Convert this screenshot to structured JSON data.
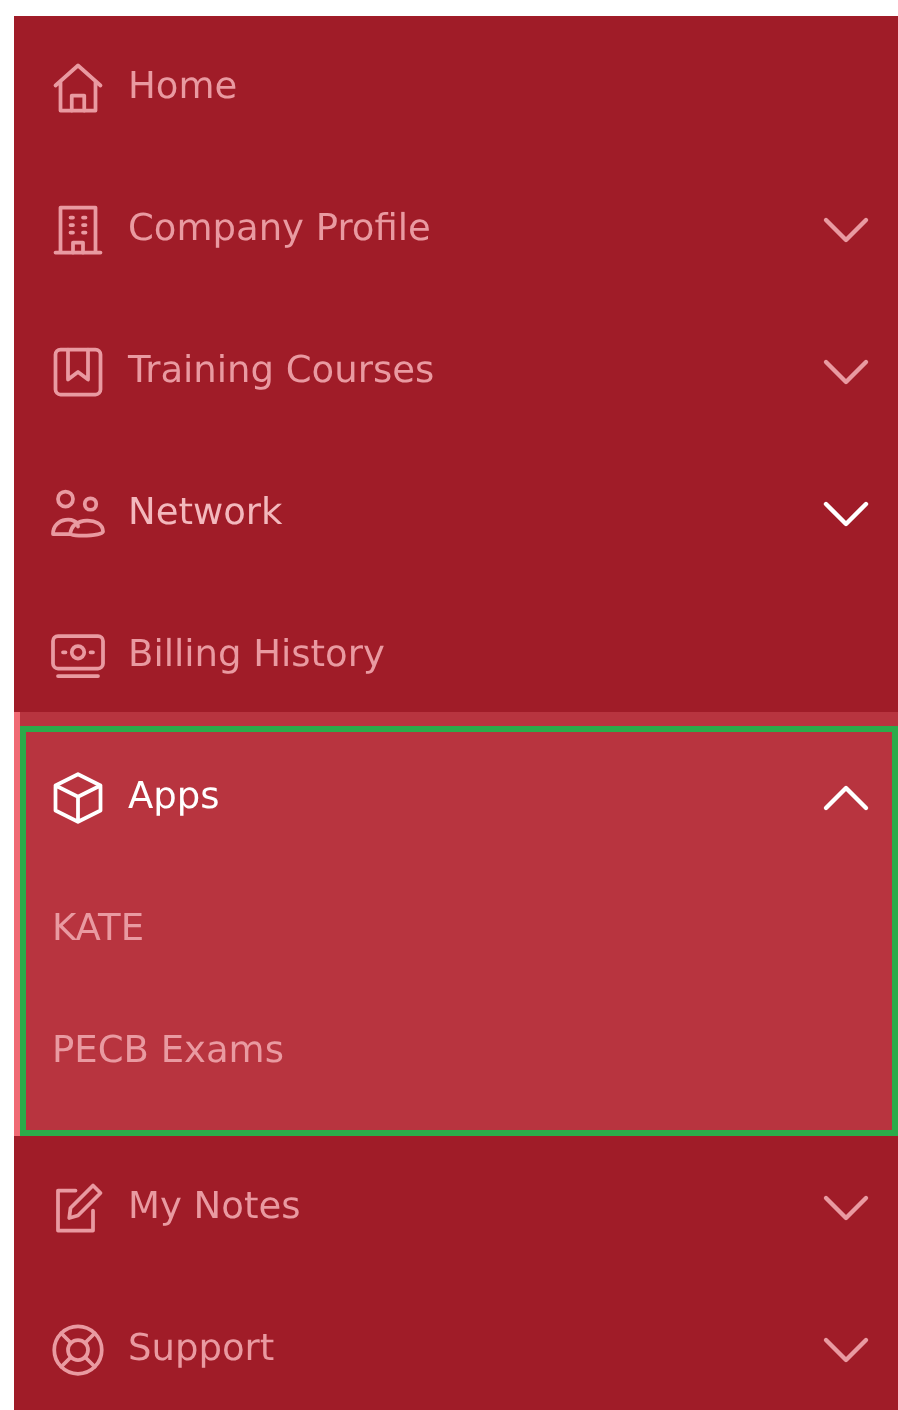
{
  "menu": [
    {
      "label": "Home",
      "kind": "link",
      "active": false,
      "focused": false
    },
    {
      "label": "Company Profile",
      "kind": "group",
      "expanded": false,
      "active": false,
      "focused": false,
      "hovered": false
    },
    {
      "label": "Training Courses",
      "kind": "group",
      "expanded": false,
      "active": false,
      "focused": false,
      "hovered": false
    },
    {
      "label": "Network",
      "kind": "group",
      "expanded": false,
      "active": false,
      "focused": false,
      "hovered": true
    },
    {
      "label": "Billing History",
      "kind": "link",
      "active": false,
      "focused": false
    },
    {
      "label": "Apps",
      "kind": "group",
      "expanded": true,
      "active": true,
      "focused": true,
      "hovered": false,
      "children": [
        {
          "label": "KATE"
        },
        {
          "label": "PECB Exams"
        }
      ]
    },
    {
      "label": "My Notes",
      "kind": "group",
      "expanded": false,
      "active": false,
      "focused": false,
      "hovered": false
    },
    {
      "label": "Support",
      "kind": "group",
      "expanded": false,
      "active": false,
      "focused": false,
      "hovered": false
    }
  ]
}
